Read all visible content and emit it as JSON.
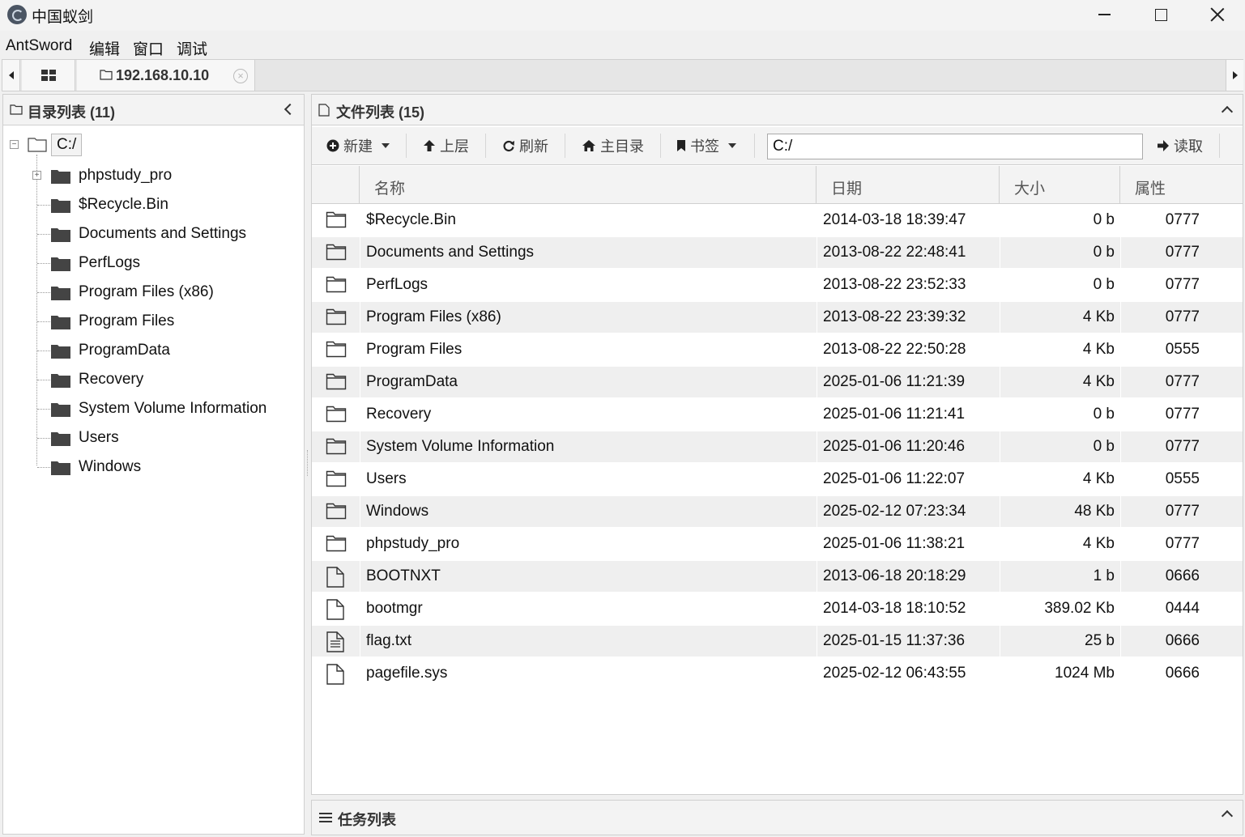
{
  "window": {
    "title": "中国蚁剑"
  },
  "menu": [
    "AntSword",
    "编辑",
    "窗口",
    "调试"
  ],
  "tabs": {
    "host": "192.168.10.10"
  },
  "left_panel": {
    "title": "目录列表 (11)",
    "root": "C:/",
    "items": [
      {
        "label": "phpstudy_pro",
        "expandable": true
      },
      {
        "label": "$Recycle.Bin",
        "expandable": false
      },
      {
        "label": "Documents and Settings",
        "expandable": false
      },
      {
        "label": "PerfLogs",
        "expandable": false
      },
      {
        "label": "Program Files (x86)",
        "expandable": false
      },
      {
        "label": "Program Files",
        "expandable": false
      },
      {
        "label": "ProgramData",
        "expandable": false
      },
      {
        "label": "Recovery",
        "expandable": false
      },
      {
        "label": "System Volume Information",
        "expandable": false
      },
      {
        "label": "Users",
        "expandable": false
      },
      {
        "label": "Windows",
        "expandable": false
      }
    ]
  },
  "right_panel": {
    "title": "文件列表 (15)",
    "toolbar": {
      "new_label": "新建",
      "up_label": "上层",
      "refresh_label": "刷新",
      "home_label": "主目录",
      "bookmark_label": "书签",
      "path_value": "C:/",
      "read_label": "读取"
    },
    "columns": [
      "名称",
      "日期",
      "大小",
      "属性"
    ],
    "rows": [
      {
        "type": "folder",
        "name": "$Recycle.Bin",
        "date": "2014-03-18 18:39:47",
        "size": "0 b",
        "attr": "0777"
      },
      {
        "type": "folder",
        "name": "Documents and Settings",
        "date": "2013-08-22 22:48:41",
        "size": "0 b",
        "attr": "0777"
      },
      {
        "type": "folder",
        "name": "PerfLogs",
        "date": "2013-08-22 23:52:33",
        "size": "0 b",
        "attr": "0777"
      },
      {
        "type": "folder",
        "name": "Program Files (x86)",
        "date": "2013-08-22 23:39:32",
        "size": "4 Kb",
        "attr": "0777"
      },
      {
        "type": "folder",
        "name": "Program Files",
        "date": "2013-08-22 22:50:28",
        "size": "4 Kb",
        "attr": "0555"
      },
      {
        "type": "folder",
        "name": "ProgramData",
        "date": "2025-01-06 11:21:39",
        "size": "4 Kb",
        "attr": "0777"
      },
      {
        "type": "folder",
        "name": "Recovery",
        "date": "2025-01-06 11:21:41",
        "size": "0 b",
        "attr": "0777"
      },
      {
        "type": "folder",
        "name": "System Volume Information",
        "date": "2025-01-06 11:20:46",
        "size": "0 b",
        "attr": "0777"
      },
      {
        "type": "folder",
        "name": "Users",
        "date": "2025-01-06 11:22:07",
        "size": "4 Kb",
        "attr": "0555"
      },
      {
        "type": "folder",
        "name": "Windows",
        "date": "2025-02-12 07:23:34",
        "size": "48 Kb",
        "attr": "0777"
      },
      {
        "type": "folder",
        "name": "phpstudy_pro",
        "date": "2025-01-06 11:38:21",
        "size": "4 Kb",
        "attr": "0777"
      },
      {
        "type": "file",
        "name": "BOOTNXT",
        "date": "2013-06-18 20:18:29",
        "size": "1 b",
        "attr": "0666"
      },
      {
        "type": "file",
        "name": "bootmgr",
        "date": "2014-03-18 18:10:52",
        "size": "389.02 Kb",
        "attr": "0444"
      },
      {
        "type": "text-file",
        "name": "flag.txt",
        "date": "2025-01-15 11:37:36",
        "size": "25 b",
        "attr": "0666"
      },
      {
        "type": "file",
        "name": "pagefile.sys",
        "date": "2025-02-12 06:43:55",
        "size": "1024 Mb",
        "attr": "0666"
      }
    ]
  },
  "bottom_panel": {
    "title": "任务列表"
  }
}
